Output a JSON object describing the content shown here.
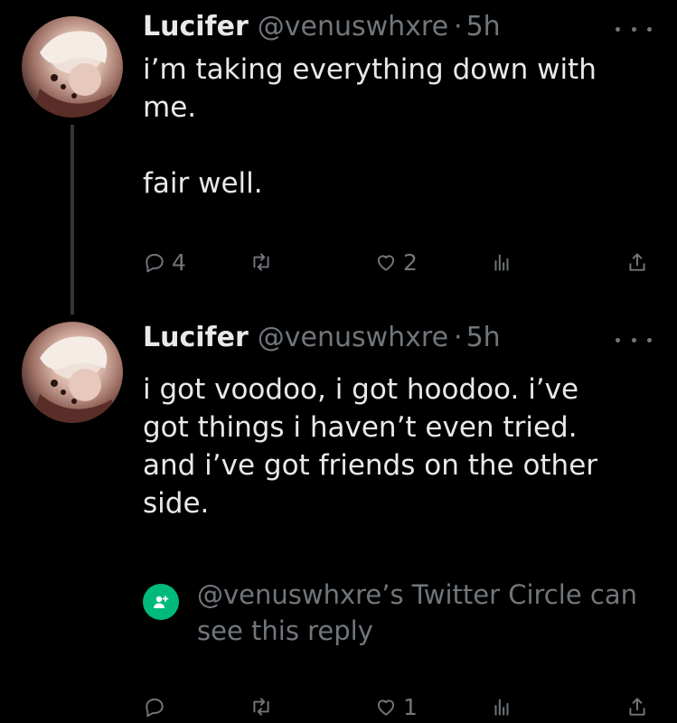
{
  "tweets": [
    {
      "display_name": "Lucifer",
      "handle": "@venuswhxre",
      "separator": "·",
      "time": "5h",
      "text": "i’m taking everything down with me.\n\nfair well.",
      "actions": {
        "reply_count": "4",
        "retweet_count": "",
        "like_count": "2",
        "views_count": ""
      }
    },
    {
      "display_name": "Lucifer",
      "handle": "@venuswhxre",
      "separator": "·",
      "time": "5h",
      "text": "i got voodoo, i got hoodoo. i’ve got things i haven’t even tried. and i’ve got friends on the other side.",
      "circle_notice": "@venuswhxre’s Twitter Circle can see this reply",
      "actions": {
        "reply_count": "",
        "retweet_count": "",
        "like_count": "1",
        "views_count": ""
      }
    }
  ],
  "colors": {
    "background": "#000000",
    "text_primary": "#e7e9ea",
    "text_secondary": "#71767b",
    "circle_green": "#00ba7c"
  },
  "icons": [
    "reply-icon",
    "retweet-icon",
    "like-icon",
    "views-icon",
    "share-icon",
    "more-icon",
    "twitter-circle-icon"
  ]
}
